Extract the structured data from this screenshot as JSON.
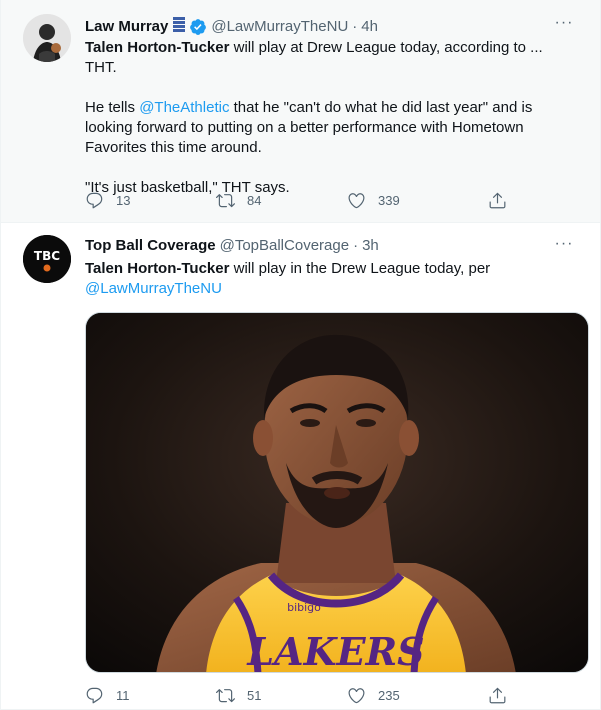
{
  "tweets": [
    {
      "author_name": "Law Murray",
      "author_handle": "@LawMurrayTheNU",
      "separator": "·",
      "time": "4h",
      "paragraphs": {
        "p1_bold": "Talen Horton-Tucker",
        "p1_rest": " will play at Drew League today, according to ... THT.",
        "p2_pre": "He tells ",
        "p2_mention": "@TheAthletic",
        "p2_post": " that he \"can't do what he did last year\" and is looking forward to putting on a better performance with Hometown Favorites this time around.",
        "p3": "\"It's just basketball,\" THT says."
      },
      "replies": "13",
      "retweets": "84",
      "likes": "339",
      "more_label": "···"
    },
    {
      "author_name": "Top Ball Coverage",
      "author_handle": "@TopBallCoverage",
      "separator": "·",
      "time": "3h",
      "avatar_text": "TBC",
      "text_bold": "Talen Horton-Tucker",
      "text_rest": " will play in the Drew League today, per",
      "text_mention": "@LawMurrayTheNU",
      "replies": "11",
      "retweets": "51",
      "likes": "235",
      "more_label": "···",
      "jersey_text": "LAKERS",
      "patch_text": "bibigo"
    }
  ],
  "colors": {
    "accent": "#1d9bf0",
    "muted": "#536471",
    "text": "#0f1419",
    "highlight_bg": "#f7f9f9",
    "lakers_gold": "#fdb927",
    "lakers_purple": "#552583"
  },
  "icons": [
    "reply-icon",
    "retweet-icon",
    "like-icon",
    "share-icon",
    "verified-icon",
    "more-icon",
    "emoji-badge-icon"
  ]
}
